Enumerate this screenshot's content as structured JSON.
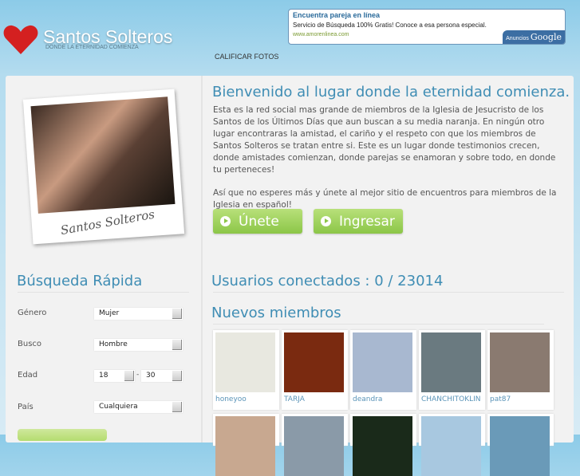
{
  "header": {
    "logo": "Santos Solteros",
    "tagline": "DONDE LA ETERNIDAD COMIENZA",
    "nav": [
      "CALIFICAR FOTOS"
    ]
  },
  "ad": {
    "title": "Encuentra pareja en línea",
    "description": "Servicio de Búsqueda 100% Gratis! Conoce a esa persona especial.",
    "url": "www.amorenlinea.com",
    "badge_prefix": "Anuncios",
    "badge_brand": "Google"
  },
  "hero": {
    "photo_caption": "Santos Solteros",
    "title": "Bienvenido al lugar donde la eternidad comienza.",
    "paragraph1": "Esta es la red social mas grande de miembros de la Iglesia de Jesucristo de los Santos de los Últimos Días que aun buscan a su media naranja. En ningún otro lugar encontraras la amistad, el cariño y el respeto con que los miembros de Santos Solteros se tratan entre si. Este es un lugar donde testimonios crecen, donde amistades comienzan, donde parejas se enamoran y sobre todo, en donde tu perteneces!",
    "paragraph2": "Así que no esperes más y únete al mejor sitio de encuentros para miembros de la Iglesia en español!",
    "join": "Únete",
    "login": "Ingresar"
  },
  "search": {
    "title": "Búsqueda Rápida",
    "gender_label": "Género",
    "gender": "Mujer",
    "seek_label": "Busco",
    "seek": "Hombre",
    "age_label": "Edad",
    "age_min": "18",
    "age_sep": "-",
    "age_max": "30",
    "country_label": "País",
    "country": "Cualquiera"
  },
  "online": {
    "title": "Usuarios conectados : 0 / 23014"
  },
  "members": {
    "title": "Nuevos miembros",
    "items": [
      {
        "name": "honeyoo",
        "color": "#e8e8e0"
      },
      {
        "name": "TARJA",
        "color": "#7a2a10"
      },
      {
        "name": "deandra",
        "color": "#a8b8d0"
      },
      {
        "name": "CHANCHITOKLIN",
        "color": "#6a7a80"
      },
      {
        "name": "pat87",
        "color": "#8a7a70"
      }
    ],
    "row2_colors": [
      "#c8a890",
      "#8a9aa8",
      "#1a2a1a",
      "#a8c8e0",
      "#6a9ab8"
    ]
  }
}
